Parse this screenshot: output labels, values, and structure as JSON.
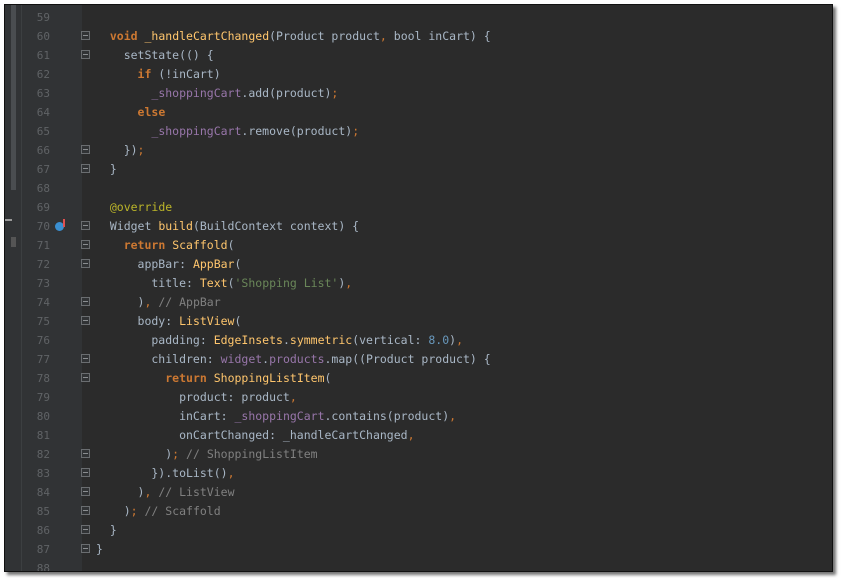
{
  "editor": {
    "language": "dart",
    "lines": [
      {
        "n": "59",
        "segs": []
      },
      {
        "n": "60",
        "segs": [
          {
            "t": "  "
          },
          {
            "t": "void",
            "c": "k"
          },
          {
            "t": " "
          },
          {
            "t": "_handleCartChanged",
            "c": "fn"
          },
          {
            "t": "(Product product"
          },
          {
            "t": ",",
            "c": "punc"
          },
          {
            "t": " bool inCart) {"
          }
        ]
      },
      {
        "n": "61",
        "segs": [
          {
            "t": "    setState(() {"
          }
        ]
      },
      {
        "n": "62",
        "segs": [
          {
            "t": "      "
          },
          {
            "t": "if",
            "c": "k"
          },
          {
            "t": " (!inCart)"
          }
        ]
      },
      {
        "n": "63",
        "segs": [
          {
            "t": "        "
          },
          {
            "t": "_shoppingCart",
            "c": "field"
          },
          {
            "t": ".add(product)"
          },
          {
            "t": ";",
            "c": "punc"
          }
        ]
      },
      {
        "n": "64",
        "segs": [
          {
            "t": "      "
          },
          {
            "t": "else",
            "c": "k"
          }
        ]
      },
      {
        "n": "65",
        "segs": [
          {
            "t": "        "
          },
          {
            "t": "_shoppingCart",
            "c": "field"
          },
          {
            "t": ".remove(product)"
          },
          {
            "t": ";",
            "c": "punc"
          }
        ]
      },
      {
        "n": "66",
        "segs": [
          {
            "t": "    })"
          },
          {
            "t": ";",
            "c": "punc"
          }
        ]
      },
      {
        "n": "67",
        "segs": [
          {
            "t": "  }"
          }
        ]
      },
      {
        "n": "68",
        "segs": []
      },
      {
        "n": "69",
        "segs": [
          {
            "t": "  "
          },
          {
            "t": "@override",
            "c": "ann"
          }
        ]
      },
      {
        "n": "70",
        "segs": [
          {
            "t": "  Widget "
          },
          {
            "t": "build",
            "c": "fn"
          },
          {
            "t": "(BuildContext context) {"
          }
        ]
      },
      {
        "n": "71",
        "segs": [
          {
            "t": "    "
          },
          {
            "t": "return",
            "c": "k"
          },
          {
            "t": " "
          },
          {
            "t": "Scaffold",
            "c": "fn"
          },
          {
            "t": "("
          }
        ]
      },
      {
        "n": "72",
        "segs": [
          {
            "t": "      appBar: "
          },
          {
            "t": "AppBar",
            "c": "fn"
          },
          {
            "t": "("
          }
        ]
      },
      {
        "n": "73",
        "segs": [
          {
            "t": "        title: "
          },
          {
            "t": "Text",
            "c": "fn"
          },
          {
            "t": "("
          },
          {
            "t": "'Shopping List'",
            "c": "str"
          },
          {
            "t": ")"
          },
          {
            "t": ",",
            "c": "punc"
          }
        ]
      },
      {
        "n": "74",
        "segs": [
          {
            "t": "      )"
          },
          {
            "t": ",",
            "c": "punc"
          },
          {
            "t": " "
          },
          {
            "t": "// AppBar",
            "c": "com"
          }
        ]
      },
      {
        "n": "75",
        "segs": [
          {
            "t": "      body: "
          },
          {
            "t": "ListView",
            "c": "fn"
          },
          {
            "t": "("
          }
        ]
      },
      {
        "n": "76",
        "segs": [
          {
            "t": "        padding: "
          },
          {
            "t": "EdgeInsets",
            "c": "fn"
          },
          {
            "t": "."
          },
          {
            "t": "symmetric",
            "c": "fn"
          },
          {
            "t": "(vertical: "
          },
          {
            "t": "8.0",
            "c": "num"
          },
          {
            "t": ")"
          },
          {
            "t": ",",
            "c": "punc"
          }
        ]
      },
      {
        "n": "77",
        "segs": [
          {
            "t": "        children: "
          },
          {
            "t": "widget",
            "c": "field"
          },
          {
            "t": "."
          },
          {
            "t": "products",
            "c": "field"
          },
          {
            "t": ".map((Product product) {"
          }
        ]
      },
      {
        "n": "78",
        "segs": [
          {
            "t": "          "
          },
          {
            "t": "return",
            "c": "k"
          },
          {
            "t": " "
          },
          {
            "t": "ShoppingListItem",
            "c": "fn"
          },
          {
            "t": "("
          }
        ]
      },
      {
        "n": "79",
        "segs": [
          {
            "t": "            product: product"
          },
          {
            "t": ",",
            "c": "punc"
          }
        ]
      },
      {
        "n": "80",
        "segs": [
          {
            "t": "            inCart: "
          },
          {
            "t": "_shoppingCart",
            "c": "field"
          },
          {
            "t": ".contains(product)"
          },
          {
            "t": ",",
            "c": "punc"
          }
        ]
      },
      {
        "n": "81",
        "segs": [
          {
            "t": "            onCartChanged: _handleCartChanged"
          },
          {
            "t": ",",
            "c": "punc"
          }
        ]
      },
      {
        "n": "82",
        "segs": [
          {
            "t": "          )"
          },
          {
            "t": ";",
            "c": "punc"
          },
          {
            "t": " "
          },
          {
            "t": "// ShoppingListItem",
            "c": "com"
          }
        ]
      },
      {
        "n": "83",
        "segs": [
          {
            "t": "        }).toList()"
          },
          {
            "t": ",",
            "c": "punc"
          }
        ]
      },
      {
        "n": "84",
        "segs": [
          {
            "t": "      )"
          },
          {
            "t": ",",
            "c": "punc"
          },
          {
            "t": " "
          },
          {
            "t": "// ListView",
            "c": "com"
          }
        ]
      },
      {
        "n": "85",
        "segs": [
          {
            "t": "    )"
          },
          {
            "t": ";",
            "c": "punc"
          },
          {
            "t": " "
          },
          {
            "t": "// Scaffold",
            "c": "com"
          }
        ]
      },
      {
        "n": "86",
        "segs": [
          {
            "t": "  }"
          }
        ]
      },
      {
        "n": "87",
        "segs": [
          {
            "t": "}"
          }
        ]
      },
      {
        "n": "88",
        "segs": []
      }
    ],
    "fold_markers": [
      "60",
      "61",
      "66",
      "67",
      "70",
      "71",
      "72",
      "74",
      "75",
      "77",
      "78",
      "82",
      "83",
      "84",
      "85",
      "86",
      "87"
    ],
    "override_gutter_line": "70",
    "override_icon": "override-method-icon"
  },
  "colors": {
    "background": "#2b2b2b",
    "keyword": "#cc7832",
    "function": "#ffc66d",
    "field": "#9876aa",
    "string": "#6a8759",
    "number": "#6897bb",
    "comment": "#808080",
    "annotation": "#bbb529"
  }
}
